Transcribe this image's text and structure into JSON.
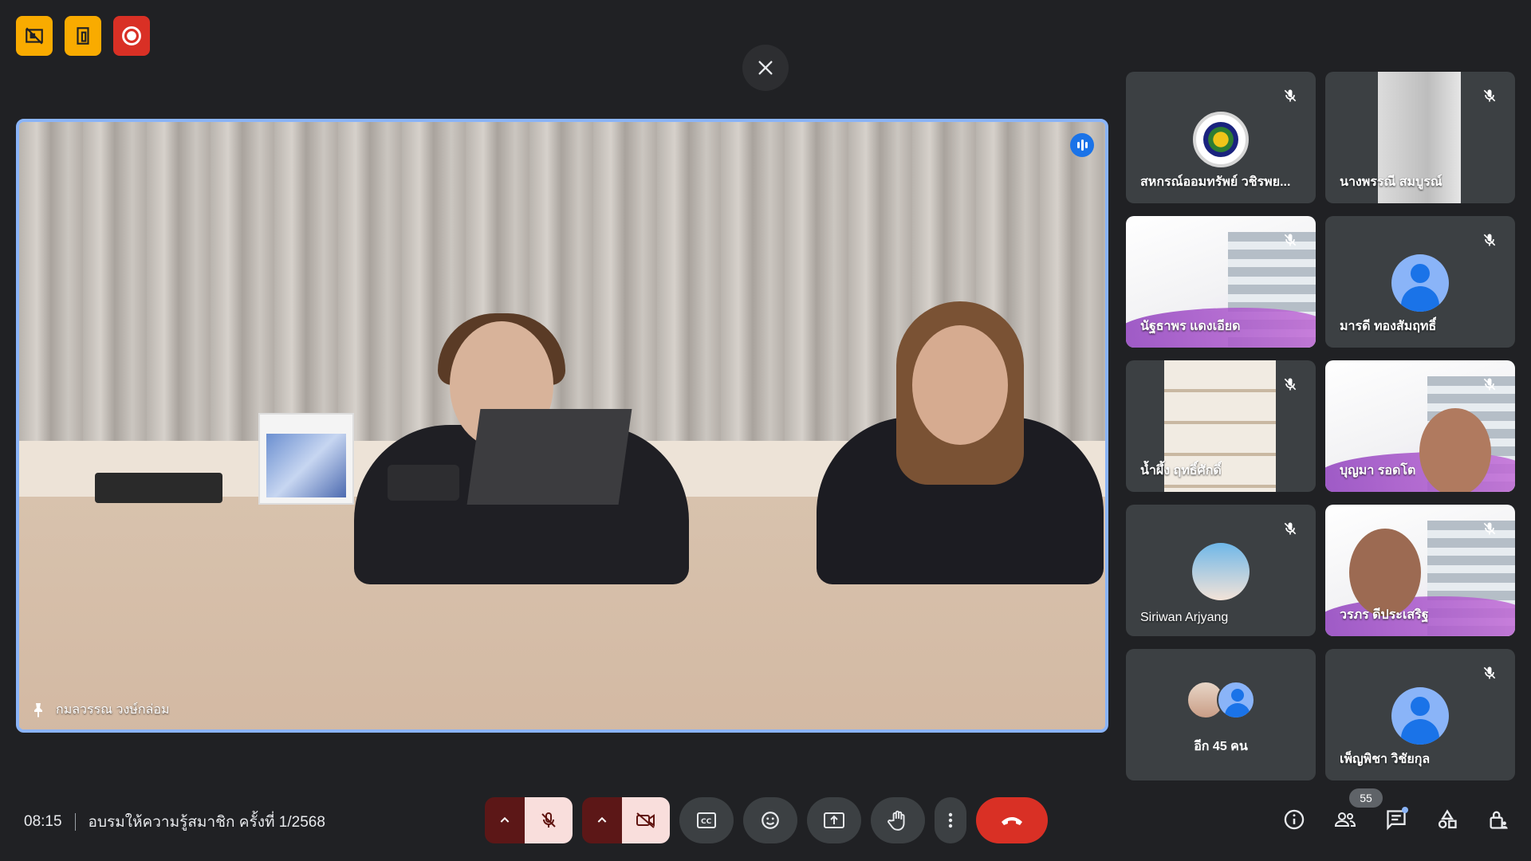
{
  "meeting": {
    "time": "08:15",
    "title": "อบรมให้ความรู้สมาชิก ครั้งที่ 1/2568"
  },
  "top_badges": [
    {
      "icon": "no-video-sharing-icon",
      "color": "#f9ab00"
    },
    {
      "icon": "door-icon",
      "color": "#f9ab00"
    },
    {
      "icon": "recording-icon",
      "color": "#d93025"
    }
  ],
  "stage": {
    "speaker_name": "กมลวรรณ วงษ์กล่อม",
    "pinned_icon": "pin-icon",
    "speaking_indicator": "speaking-icon"
  },
  "tiles": [
    {
      "name": "สหกรณ์ออมทรัพย์ วชิรพย...",
      "kind": "logo",
      "muted": true
    },
    {
      "name": "นางพรรณี สมบูรณ์",
      "kind": "video-wall",
      "muted": true
    },
    {
      "name": "นัฐธาพร แดงเอียด",
      "kind": "slide",
      "muted": true
    },
    {
      "name": "มารดี ทองสัมฤทธิ์",
      "kind": "avatar",
      "muted": true
    },
    {
      "name": "น้ำผึ้ง ฤทธิ์ศักดิ์",
      "kind": "shelf",
      "muted": true
    },
    {
      "name": "บุญมา รอดโต",
      "kind": "slide-face",
      "muted": true
    },
    {
      "name": "Siriwan Arjyang",
      "kind": "photo-avatar",
      "muted": true
    },
    {
      "name": "วรภร ดีประเสริฐ",
      "kind": "slide-face",
      "muted": true
    },
    {
      "name": "อีก 45 คน",
      "kind": "more",
      "muted": false
    },
    {
      "name": "เพ็ญพิชา วิชัยกุล",
      "kind": "avatar",
      "muted": true
    }
  ],
  "participants_count": "55",
  "controls": {
    "mic": "mic-off-icon",
    "camera": "camera-off-icon",
    "captions": "captions-icon",
    "emoji": "emoji-icon",
    "present": "present-icon",
    "raise_hand": "hand-icon",
    "more": "more-vert-icon",
    "leave": "call-end-icon"
  },
  "colors": {
    "background": "#202124",
    "tile": "#3c4043",
    "active_border": "#8ab4f8",
    "hangup": "#d93025",
    "muted_button": "#f9dedc"
  }
}
